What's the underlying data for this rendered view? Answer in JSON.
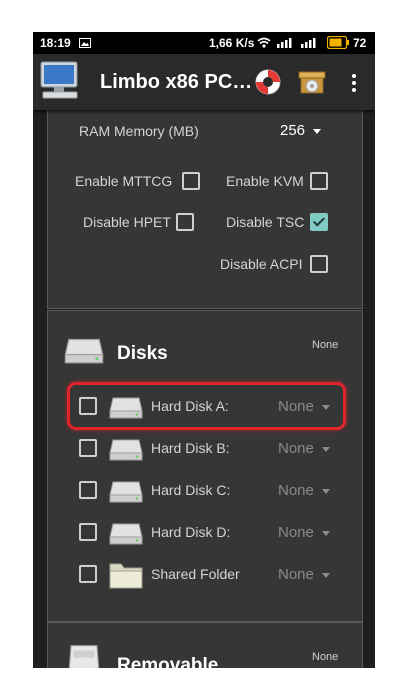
{
  "status_bar": {
    "time": "18:19",
    "network_speed": "1,66 K/s",
    "battery_level": "72"
  },
  "app_bar": {
    "title": "Limbo x86 PC…",
    "icons": [
      "computer-icon",
      "lifebuoy-icon",
      "package-icon",
      "more-vert-icon"
    ]
  },
  "machine": {
    "ram_label": "RAM Memory (MB)",
    "ram_value": "256",
    "options": [
      {
        "label": "Enable  MTTCG",
        "checked": false
      },
      {
        "label": "Enable KVM",
        "checked": false
      },
      {
        "label": "Disable HPET",
        "checked": false
      },
      {
        "label": "Disable TSC",
        "checked": true
      },
      {
        "label": "Disable ACPI",
        "checked": false
      }
    ]
  },
  "disks": {
    "title": "Disks",
    "summary": "None",
    "items": [
      {
        "label": "Hard Disk A:",
        "value": "None",
        "checked": false
      },
      {
        "label": "Hard Disk B:",
        "value": "None",
        "checked": false
      },
      {
        "label": "Hard Disk C:",
        "value": "None",
        "checked": false
      },
      {
        "label": "Hard Disk D:",
        "value": "None",
        "checked": false
      },
      {
        "label": "Shared Folder",
        "value": "None",
        "checked": false
      }
    ]
  },
  "removable": {
    "title": "Removable",
    "summary": "None"
  },
  "colors": {
    "highlight": "#e0252b",
    "checkbox_accent": "#80cbc4",
    "panel_bg": "#363636",
    "app_bar_bg": "#2a2a2a"
  }
}
